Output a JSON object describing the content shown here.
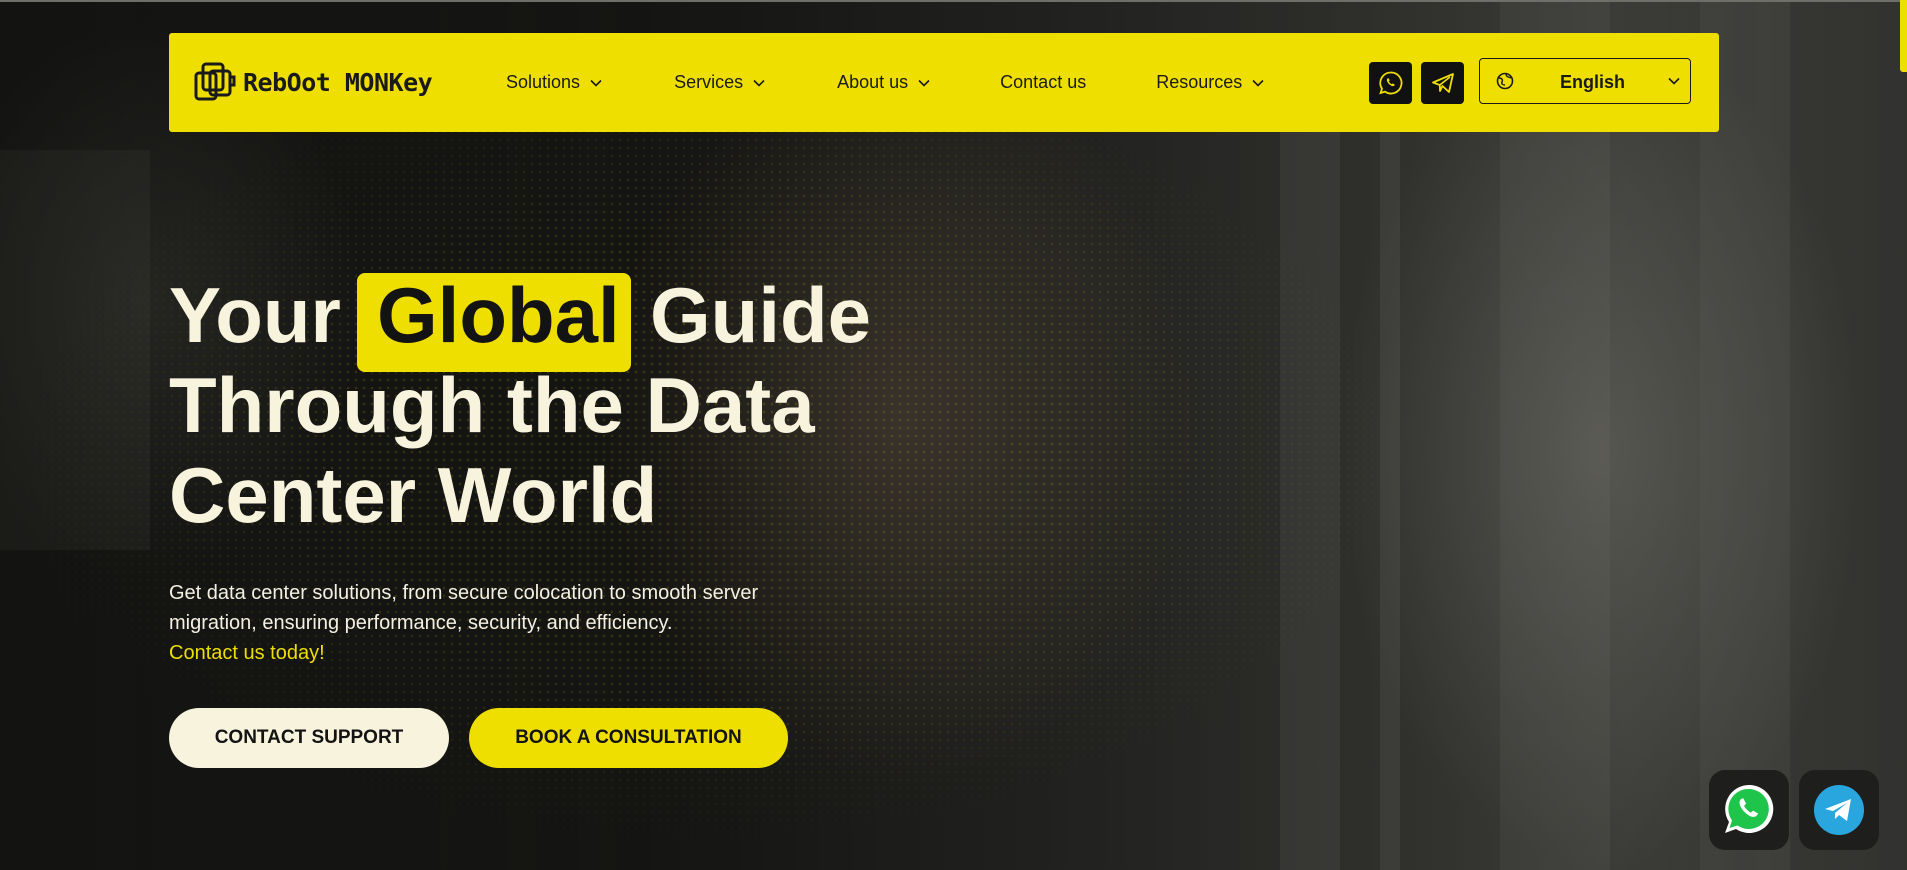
{
  "brand": {
    "logo_text": "RebOot MONKey",
    "accent": "#efdf00",
    "text_light": "#f7f3dc"
  },
  "nav": {
    "items": [
      {
        "label": "Solutions",
        "has_dropdown": true
      },
      {
        "label": "Services",
        "has_dropdown": true
      },
      {
        "label": "About us",
        "has_dropdown": true
      },
      {
        "label": "Contact us",
        "has_dropdown": false
      },
      {
        "label": "Resources",
        "has_dropdown": true
      }
    ],
    "icons": [
      "whatsapp-icon",
      "telegram-icon"
    ],
    "language": {
      "selected": "English",
      "icon": "globe-icon"
    }
  },
  "hero": {
    "headline": {
      "word1": "Your",
      "highlight": "Global",
      "word3": "Guide",
      "line2": "Through the Data",
      "line3": "Center World"
    },
    "description": "Get data center solutions, from secure colocation to smooth server migration, ensuring performance, security, and efficiency.",
    "cta_link": "Contact us today!",
    "buttons": {
      "support": "CONTACT SUPPORT",
      "consult": "BOOK A CONSULTATION"
    }
  },
  "floating": [
    "whatsapp-chat-icon",
    "telegram-chat-icon"
  ]
}
